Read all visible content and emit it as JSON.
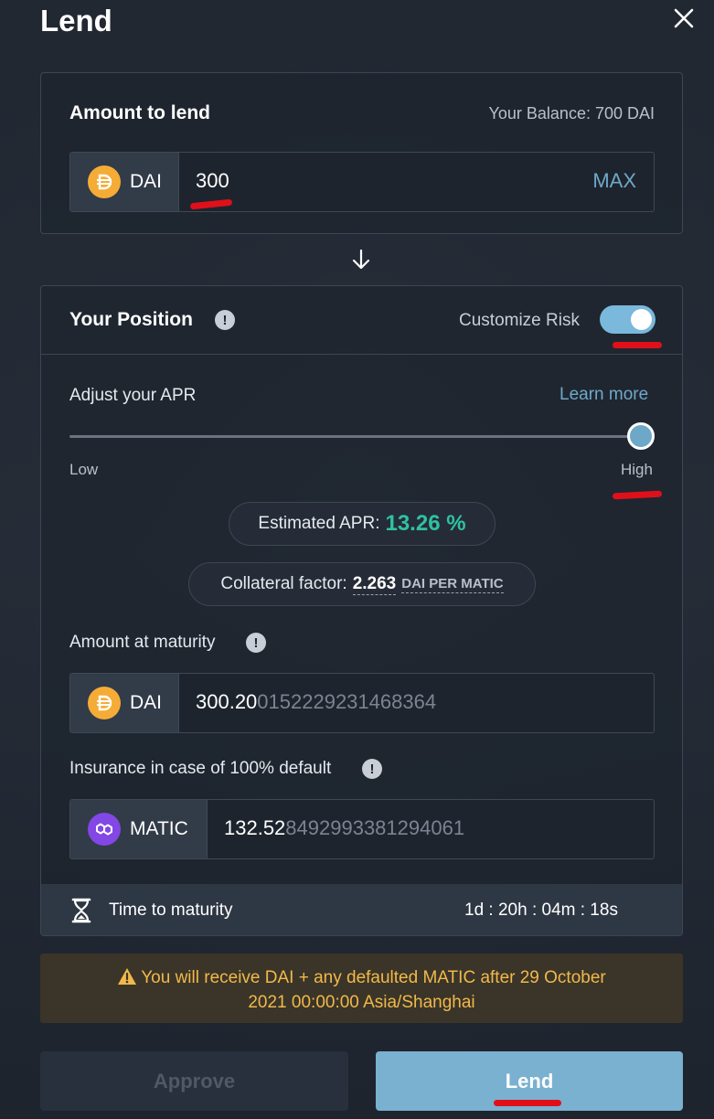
{
  "header": {
    "title": "Lend"
  },
  "amount_card": {
    "title": "Amount to lend",
    "balance": "Your Balance: 700 DAI",
    "token": "DAI",
    "value": "300",
    "max_label": "MAX"
  },
  "position_card": {
    "title": "Your Position",
    "customize_label": "Customize Risk",
    "customize_on": true,
    "adjust_label": "Adjust your APR",
    "learn_more": "Learn more",
    "slider_low": "Low",
    "slider_high": "High",
    "slider_level": 1.0,
    "estimated_apr_label": "Estimated APR:",
    "estimated_apr_value": "13.26 %",
    "collateral_label": "Collateral factor:",
    "collateral_value": "2.263",
    "collateral_unit": "DAI PER MATIC",
    "maturity_amount_label": "Amount at maturity",
    "maturity_token": "DAI",
    "maturity_value_main": "300.20",
    "maturity_value_rest": "0152229231468364",
    "insurance_label": "Insurance in case of 100% default",
    "insurance_token": "MATIC",
    "insurance_value_main": "132.52",
    "insurance_value_rest": "8492993381294061",
    "time_label": "Time to maturity",
    "time_value": "1d : 20h : 04m : 18s"
  },
  "warning": {
    "line1": "You will receive DAI + any defaulted MATIC after 29 October",
    "line2": "2021 00:00:00 Asia/Shanghai"
  },
  "buttons": {
    "approve": "Approve",
    "lend": "Lend"
  },
  "colors": {
    "accent": "#7ab1d0",
    "apr_green": "#2fc2a0",
    "warning_text": "#f2b84b",
    "annotation_red": "#e0101a",
    "dai_coin": "#f5ac37",
    "matic_coin": "#8247e5"
  }
}
